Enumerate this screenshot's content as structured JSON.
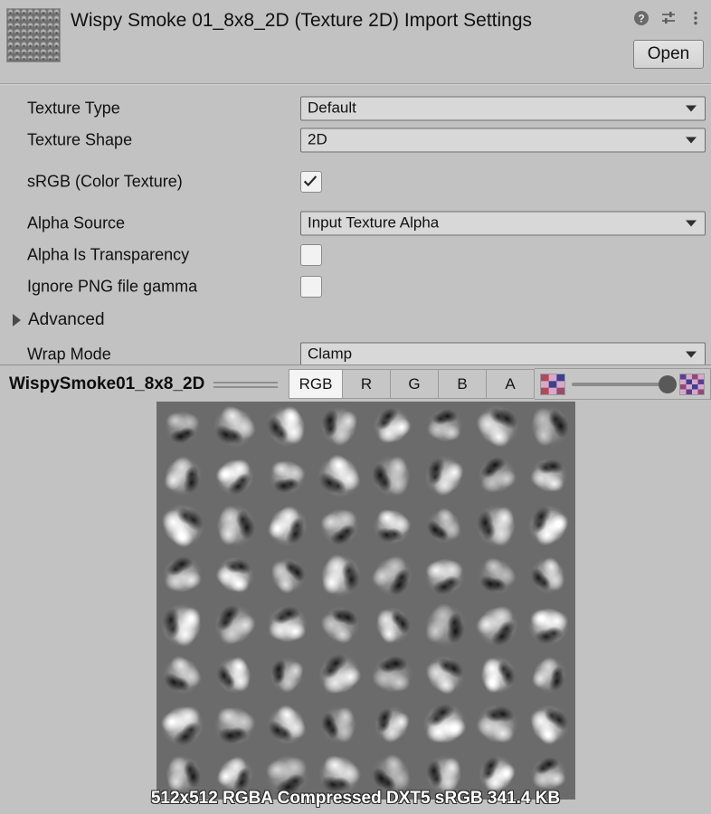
{
  "header": {
    "title": "Wispy Smoke 01_8x8_2D (Texture 2D) Import Settings",
    "thumbnail_name": "texture-thumbnail",
    "icons": [
      {
        "name": "help-icon",
        "label": "?"
      },
      {
        "name": "preset-icon",
        "label": "Preset"
      },
      {
        "name": "more-menu-icon",
        "label": "More"
      }
    ],
    "open_label": "Open"
  },
  "properties": [
    {
      "label": "Texture Type",
      "type": "dropdown",
      "value": "Default",
      "name": "texture-type"
    },
    {
      "label": "Texture Shape",
      "type": "dropdown",
      "value": "2D",
      "name": "texture-shape"
    },
    {
      "label": "sRGB (Color Texture)",
      "type": "checkbox",
      "checked": true,
      "name": "srgb-color-texture"
    },
    {
      "label": "Alpha Source",
      "type": "dropdown",
      "value": "Input Texture Alpha",
      "name": "alpha-source"
    },
    {
      "label": "Alpha Is Transparency",
      "type": "checkbox",
      "checked": false,
      "name": "alpha-is-transparency"
    },
    {
      "label": "Ignore PNG file gamma",
      "type": "checkbox",
      "checked": false,
      "name": "ignore-png-file-gamma"
    }
  ],
  "advanced": {
    "label": "Advanced",
    "expanded": false
  },
  "clipped_row": {
    "label": "Wrap Mode",
    "value": "Clamp"
  },
  "preview": {
    "title": "WispySmoke01_8x8_2D",
    "channels": [
      {
        "label": "RGB",
        "active": true,
        "name": "channel-rgb"
      },
      {
        "label": "R",
        "active": false,
        "name": "channel-r"
      },
      {
        "label": "G",
        "active": false,
        "name": "channel-g"
      },
      {
        "label": "B",
        "active": false,
        "name": "channel-b"
      },
      {
        "label": "A",
        "active": false,
        "name": "channel-a"
      }
    ],
    "mip_slider": {
      "name": "mip-level-slider",
      "value": 100,
      "min": 0,
      "max": 100
    },
    "status": "512x512  RGBA Compressed DXT5 sRGB   341.4 KB",
    "grid_columns": 8,
    "grid_rows": 8
  },
  "colors": {
    "panel_bg": "#c2c2c2",
    "field_bg": "#d8d8d8",
    "border": "#6e6e6e",
    "preview_backdrop": "#6b6b6b",
    "text": "#111111",
    "active_tab": "#f4f4f4"
  }
}
